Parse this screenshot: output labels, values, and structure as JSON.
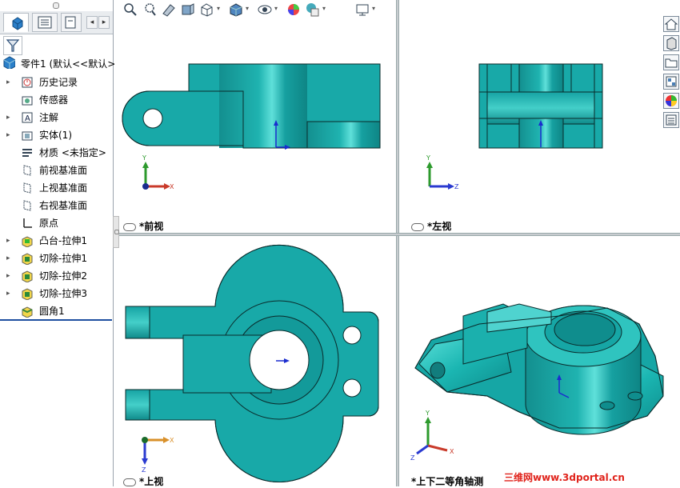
{
  "feature_tree": {
    "root": "零件1  (默认<<默认>",
    "items": [
      {
        "label": "历史记录",
        "expand": "▸",
        "icon": "history-icon"
      },
      {
        "label": "传感器",
        "expand": "",
        "icon": "sensor-icon"
      },
      {
        "label": "注解",
        "expand": "▸",
        "icon": "annotation-icon"
      },
      {
        "label": "实体(1)",
        "expand": "▸",
        "icon": "solid-bodies-icon"
      },
      {
        "label": "材质 <未指定>",
        "expand": "",
        "icon": "material-icon"
      },
      {
        "label": "前视基准面",
        "expand": "",
        "icon": "plane-icon"
      },
      {
        "label": "上视基准面",
        "expand": "",
        "icon": "plane-icon"
      },
      {
        "label": "右视基准面",
        "expand": "",
        "icon": "plane-icon"
      },
      {
        "label": "原点",
        "expand": "",
        "icon": "origin-icon"
      },
      {
        "label": "凸台-拉伸1",
        "expand": "▸",
        "icon": "boss-extrude-icon"
      },
      {
        "label": "切除-拉伸1",
        "expand": "▸",
        "icon": "cut-extrude-icon"
      },
      {
        "label": "切除-拉伸2",
        "expand": "▸",
        "icon": "cut-extrude-icon"
      },
      {
        "label": "切除-拉伸3",
        "expand": "▸",
        "icon": "cut-extrude-icon"
      },
      {
        "label": "圆角1",
        "expand": "",
        "icon": "fillet-icon"
      }
    ],
    "scroll_left": "◂",
    "scroll_right": "▸"
  },
  "viewports": {
    "front": "*前视",
    "left": "*左视",
    "top": "*上视",
    "iso": "*上下二等角轴测"
  },
  "axes": {
    "x": "X",
    "y": "Y",
    "z": "Z"
  },
  "toolbar": {
    "dropdown": "▾"
  },
  "watermark": "三维网www.3dportal.cn",
  "colors": {
    "part": "#1aa8a8",
    "part_light": "#4fd3cf",
    "part_dark": "#0c7f80",
    "edge": "#0a2a2a"
  }
}
